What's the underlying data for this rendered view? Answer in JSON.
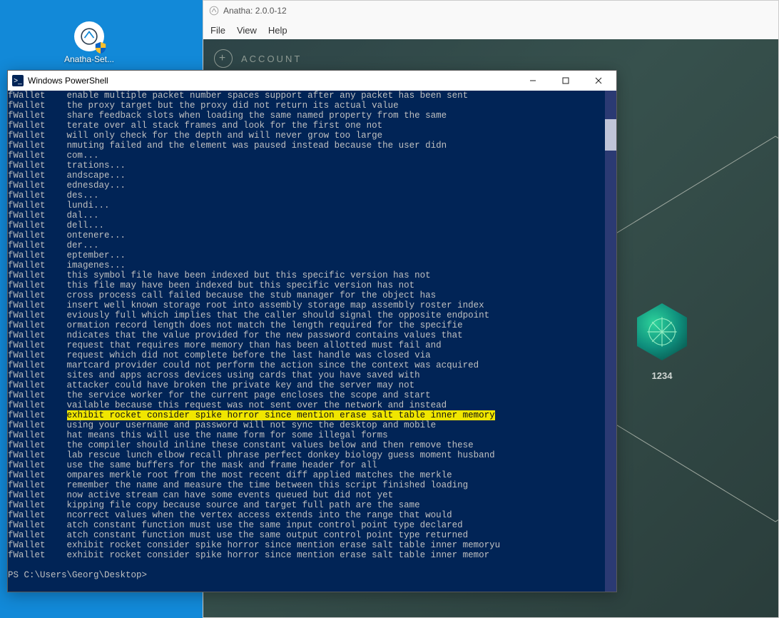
{
  "desktop": {
    "icon_label": "Anatha-Set..."
  },
  "anatha": {
    "title": "Anatha: 2.0.0-12",
    "menu": [
      "File",
      "View",
      "Help"
    ],
    "account_button": "ACCOUNT",
    "wallet_label": "1234"
  },
  "powershell": {
    "title": "Windows PowerShell",
    "prompt": "PS C:\\Users\\Georg\\Desktop>",
    "highlighted_index": 32,
    "lines": [
      {
        "tag": "fWallet",
        "msg": "enable multiple packet number spaces support after any packet has been sent"
      },
      {
        "tag": "fWallet",
        "msg": "the proxy target but the proxy did not return its actual value"
      },
      {
        "tag": "fWallet",
        "msg": "share feedback slots when loading the same named property from the same"
      },
      {
        "tag": "fWallet",
        "msg": "terate over all stack frames and look for the first one not"
      },
      {
        "tag": "fWallet",
        "msg": "will only check for the depth and will never grow too large"
      },
      {
        "tag": "fWallet",
        "msg": "nmuting failed and the element was paused instead because the user didn"
      },
      {
        "tag": "fWallet",
        "msg": "com..."
      },
      {
        "tag": "fWallet",
        "msg": "trations..."
      },
      {
        "tag": "fWallet",
        "msg": "andscape..."
      },
      {
        "tag": "fWallet",
        "msg": "ednesday..."
      },
      {
        "tag": "fWallet",
        "msg": "des..."
      },
      {
        "tag": "fWallet",
        "msg": "lundi..."
      },
      {
        "tag": "fWallet",
        "msg": "dal..."
      },
      {
        "tag": "fWallet",
        "msg": "dell..."
      },
      {
        "tag": "fWallet",
        "msg": "ontenere..."
      },
      {
        "tag": "fWallet",
        "msg": "der..."
      },
      {
        "tag": "fWallet",
        "msg": "eptember..."
      },
      {
        "tag": "fWallet",
        "msg": "imagenes..."
      },
      {
        "tag": "fWallet",
        "msg": "this symbol file have been indexed but this specific version has not"
      },
      {
        "tag": "fWallet",
        "msg": "this file may have been indexed but this specific version has not"
      },
      {
        "tag": "fWallet",
        "msg": "cross process call failed because the stub manager for the object has"
      },
      {
        "tag": "fWallet",
        "msg": "insert well known storage root into assembly storage map assembly roster index"
      },
      {
        "tag": "fWallet",
        "msg": "eviously full which implies that the caller should signal the opposite endpoint"
      },
      {
        "tag": "fWallet",
        "msg": "ormation record length does not match the length required for the specifie"
      },
      {
        "tag": "fWallet",
        "msg": "ndicates that the value provided for the new password contains values that"
      },
      {
        "tag": "fWallet",
        "msg": "request that requires more memory than has been allotted must fail and"
      },
      {
        "tag": "fWallet",
        "msg": "request which did not complete before the last handle was closed via"
      },
      {
        "tag": "fWallet",
        "msg": "martcard provider could not perform the action since the context was acquired"
      },
      {
        "tag": "fWallet",
        "msg": "sites and apps across devices using cards that you have saved with"
      },
      {
        "tag": "fWallet",
        "msg": "attacker could have broken the private key and the server may not"
      },
      {
        "tag": "fWallet",
        "msg": "the service worker for the current page encloses the scope and start"
      },
      {
        "tag": "fWallet",
        "msg": "vailable because this request was not sent over the network and instead"
      },
      {
        "tag": "fWallet",
        "msg": "exhibit rocket consider spike horror since mention erase salt table inner memory"
      },
      {
        "tag": "fWallet",
        "msg": "using your username and password will not sync the desktop and mobile"
      },
      {
        "tag": "fWallet",
        "msg": "hat means this will use the name form for some illegal forms"
      },
      {
        "tag": "fWallet",
        "msg": "the compiler should inline these constant values below and then remove these"
      },
      {
        "tag": "fWallet",
        "msg": "lab rescue lunch elbow recall phrase perfect donkey biology guess moment husband"
      },
      {
        "tag": "fWallet",
        "msg": "use the same buffers for the mask and frame header for all"
      },
      {
        "tag": "fWallet",
        "msg": "ompares merkle root from the most recent diff applied matches the merkle"
      },
      {
        "tag": "fWallet",
        "msg": "remember the name and measure the time between this script finished loading"
      },
      {
        "tag": "fWallet",
        "msg": "now active stream can have some events queued but did not yet"
      },
      {
        "tag": "fWallet",
        "msg": "kipping file copy because source and target full path are the same"
      },
      {
        "tag": "fWallet",
        "msg": "ncorrect values when the vertex access extends into the range that would"
      },
      {
        "tag": "fWallet",
        "msg": "atch constant function must use the same input control point type declared"
      },
      {
        "tag": "fWallet",
        "msg": "atch constant function must use the same output control point type returned"
      },
      {
        "tag": "fWallet",
        "msg": "exhibit rocket consider spike horror since mention erase salt table inner memoryu"
      },
      {
        "tag": "fWallet",
        "msg": "exhibit rocket consider spike horror since mention erase salt table inner memor"
      }
    ]
  }
}
